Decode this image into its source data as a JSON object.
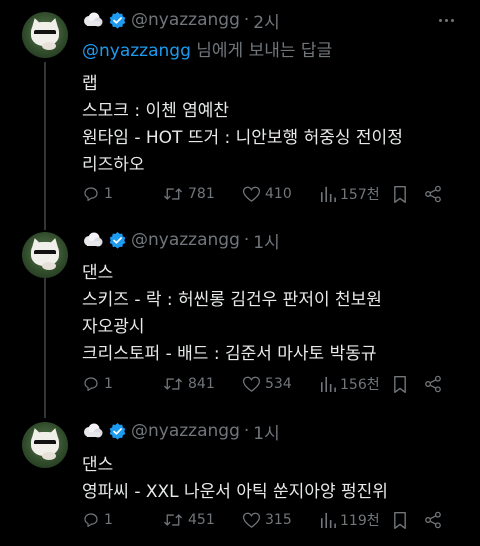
{
  "tweets": [
    {
      "handle": "@nyazzangg",
      "dot": "·",
      "time": "2시",
      "reply_to": {
        "mention": "@nyazzangg",
        "suffix": " 님에게 보내는 답글"
      },
      "lines": [
        "랩",
        "스모크 : 이첸 염예찬",
        "원타임 - HOT 뜨거 : 니안보행 허중싱 전이정",
        "리즈하오"
      ],
      "stats": {
        "replies": "1",
        "reposts": "781",
        "likes": "410",
        "views": "157천"
      }
    },
    {
      "handle": "@nyazzangg",
      "dot": "·",
      "time": "1시",
      "lines": [
        "댄스",
        "스키즈 - 락 : 허씬롱 김건우 판저이 천보원",
        "자오광시",
        "크리스토퍼 - 배드 : 김준서 마사토 박동규"
      ],
      "stats": {
        "replies": "1",
        "reposts": "841",
        "likes": "534",
        "views": "156천"
      }
    },
    {
      "handle": "@nyazzangg",
      "dot": "·",
      "time": "1시",
      "lines": [
        "댄스",
        "영파씨 - XXL 나운서 아틱 쑨지아양 펑진위"
      ],
      "stats": {
        "replies": "1",
        "reposts": "451",
        "likes": "315",
        "views": "119천"
      }
    }
  ],
  "colors": {
    "accent": "#1d9bf0",
    "muted": "#71767b",
    "text": "#e7e9ea",
    "background": "#000000"
  },
  "icons": [
    "cloud-emoji-icon",
    "verified-badge-icon",
    "more-icon",
    "reply-icon",
    "repost-icon",
    "like-icon",
    "views-icon",
    "bookmark-icon",
    "share-icon"
  ]
}
